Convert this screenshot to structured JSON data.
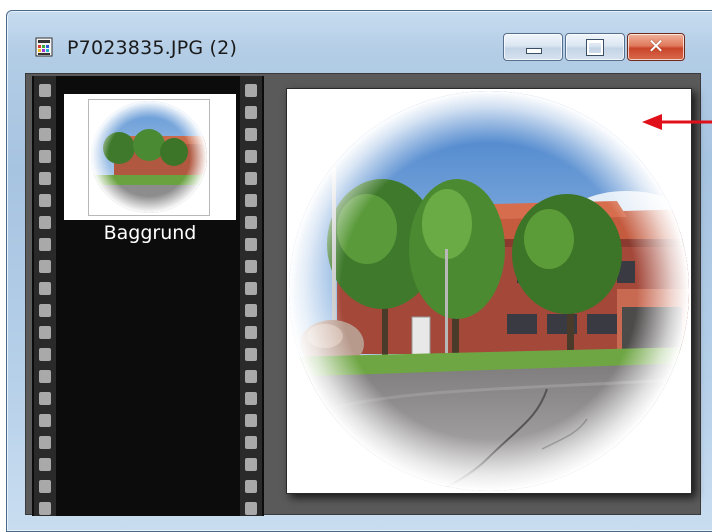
{
  "window": {
    "title": "P7023835.JPG (2)",
    "icons": {
      "app": "image-file-icon",
      "minimize": "minimize-icon",
      "maximize": "maximize-icon",
      "close": "close-icon"
    }
  },
  "layers": [
    {
      "label": "Baggrund"
    }
  ],
  "annotation": {
    "icon": "red-arrow-icon",
    "color": "#e0101a"
  },
  "colors": {
    "close_button": "#c9452a",
    "film_strip": "#0c0c0c",
    "workspace": "#5a5a5a"
  }
}
